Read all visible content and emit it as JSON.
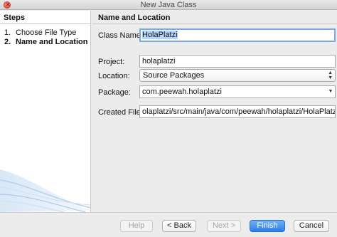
{
  "window": {
    "title": "New Java Class"
  },
  "steps": {
    "header": "Steps",
    "items": [
      {
        "num": "1.",
        "label": "Choose File Type"
      },
      {
        "num": "2.",
        "label": "Name and Location"
      }
    ]
  },
  "panel": {
    "header": "Name and Location",
    "class_name_label": "Class Name:",
    "class_name_value": "HolaPlatzi",
    "project_label": "Project:",
    "project_value": "holaplatzi",
    "location_label": "Location:",
    "location_value": "Source Packages",
    "package_label": "Package:",
    "package_value": "com.peewah.holaplatzi",
    "created_file_label": "Created File:",
    "created_file_value": "olaplatzi/src/main/java/com/peewah/holaplatzi/HolaPlatzi.java"
  },
  "buttons": {
    "help": "Help",
    "back": "< Back",
    "next": "Next >",
    "finish": "Finish",
    "cancel": "Cancel"
  },
  "colors": {
    "accent": "#2e7de6",
    "focus_ring": "#7aa7e8",
    "selection": "#b5d5ff"
  }
}
